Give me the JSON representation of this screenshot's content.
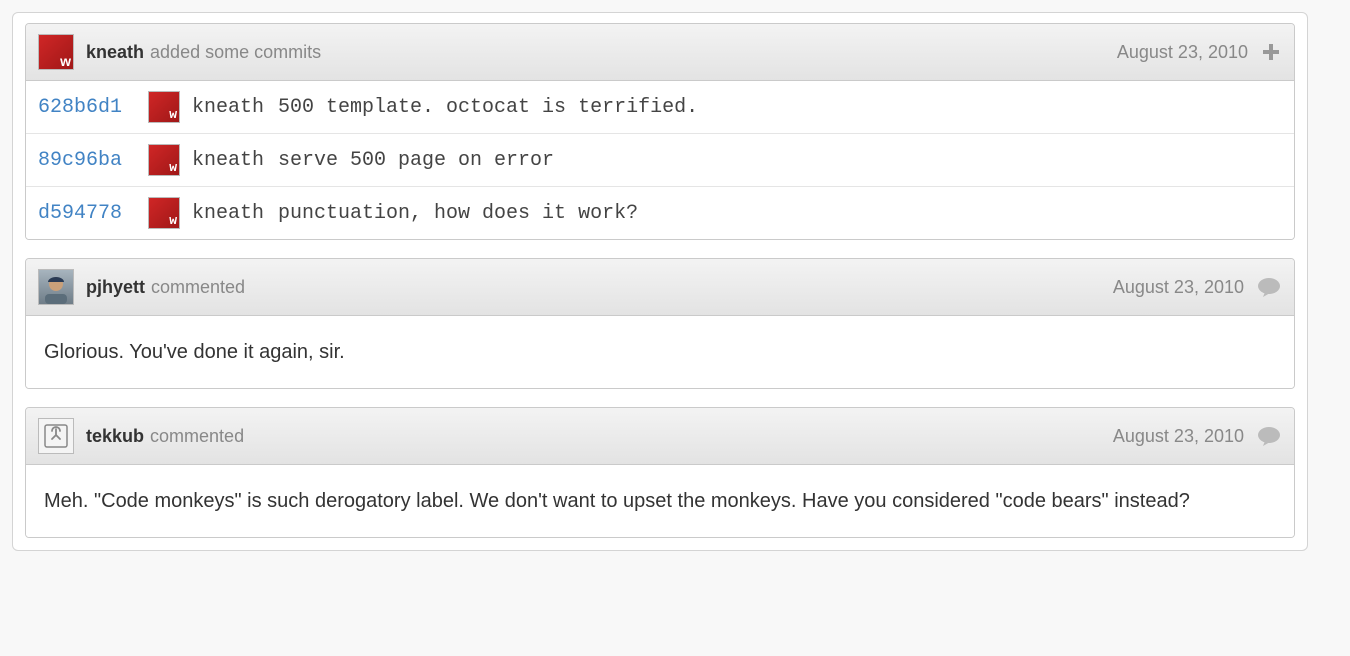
{
  "commits_block": {
    "author": "kneath",
    "action": "added some commits",
    "date": "August 23, 2010",
    "avatar_letter": "w",
    "commits": [
      {
        "sha": "628b6d1",
        "author": "kneath",
        "message": "500 template. octocat is terrified."
      },
      {
        "sha": "89c96ba",
        "author": "kneath",
        "message": "serve 500 page on error"
      },
      {
        "sha": "d594778",
        "author": "kneath",
        "message": "punctuation, how does it work?"
      }
    ]
  },
  "comments": [
    {
      "avatar": "pjhyett",
      "author": "pjhyett",
      "action": "commented",
      "date": "August 23, 2010",
      "body": "Glorious. You've done it again, sir."
    },
    {
      "avatar": "tekkub",
      "author": "tekkub",
      "action": "commented",
      "date": "August 23, 2010",
      "body": "Meh. \"Code monkeys\" is such derogatory label. We don't want to upset the monkeys. Have you considered \"code bears\" instead?"
    }
  ]
}
